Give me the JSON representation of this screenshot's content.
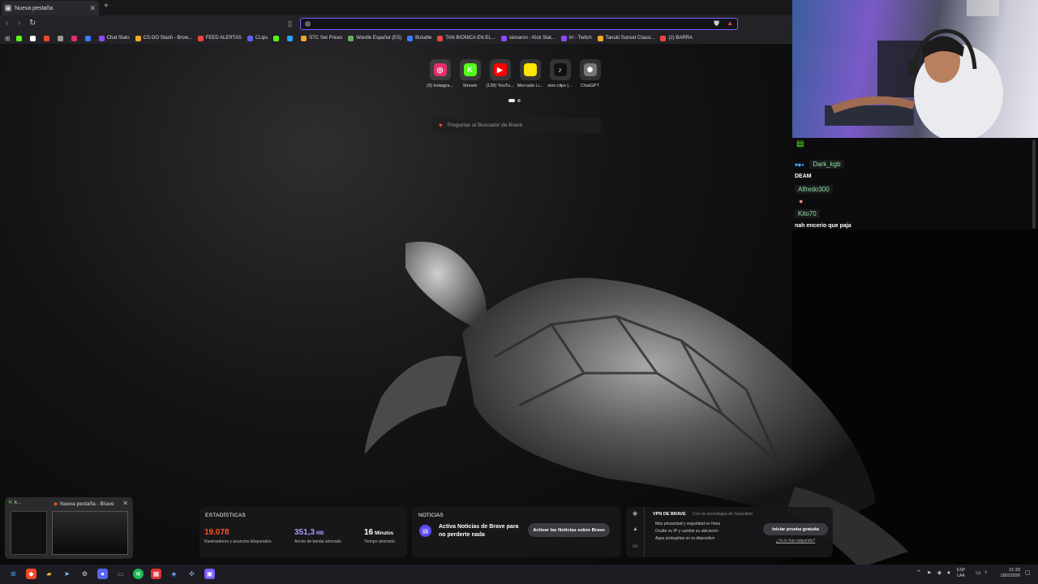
{
  "browser": {
    "tab_title": "Nueva pestaña",
    "new_tab_symbol": "+",
    "url_value": "",
    "bookmarks": [
      {
        "label": "",
        "color": "#53fc18"
      },
      {
        "label": "",
        "color": "#ffffff"
      },
      {
        "label": "",
        "color": "#f14a28"
      },
      {
        "label": "",
        "color": "#999999"
      },
      {
        "label": "",
        "color": "#e1306c"
      },
      {
        "label": "",
        "color": "#3a7afe"
      },
      {
        "label": "Chat Stats",
        "color": "#9147ff"
      },
      {
        "label": "CS:GO Stash - Brow...",
        "color": "#f1a928"
      },
      {
        "label": "FEED ALERTAS",
        "color": "#e44"
      },
      {
        "label": "CLips",
        "color": "#5865f2"
      },
      {
        "label": "",
        "color": "#53fc18"
      },
      {
        "label": "",
        "color": "#2aa4f4"
      },
      {
        "label": "STC Set Prices",
        "color": "#f1a928"
      },
      {
        "label": "Wordle Español (ES)",
        "color": "#6aaa64"
      },
      {
        "label": "Boludle",
        "color": "#3a7afe"
      },
      {
        "label": "TAN BIONICA EN EL...",
        "color": "#e44"
      },
      {
        "label": "sionaron - Kick Stat...",
        "color": "#9147ff"
      },
      {
        "label": "trr - Twitch",
        "color": "#9147ff"
      },
      {
        "label": "Tanuki Sunset Classi...",
        "color": "#f1a928"
      },
      {
        "label": "(2) BARRA",
        "color": "#e44"
      }
    ]
  },
  "newtab": {
    "top_sites": [
      {
        "label": "(9) Instagra...",
        "icon": "instagram-icon",
        "color": "#e1306c",
        "glyph": "◎"
      },
      {
        "label": "Stream",
        "icon": "kick-icon",
        "color": "#53fc18",
        "glyph": "K"
      },
      {
        "label": "(128) YouTu...",
        "icon": "youtube-icon",
        "color": "#ff0000",
        "glyph": "▶"
      },
      {
        "label": "Mercado Li...",
        "icon": "mercadolibre-icon",
        "color": "#ffe600",
        "glyph": "◌"
      },
      {
        "label": "sion.clips (...",
        "icon": "tiktok-icon",
        "color": "#111111",
        "glyph": "♪"
      },
      {
        "label": "ChatGPT",
        "icon": "chatgpt-icon",
        "color": "#777777",
        "glyph": "✺"
      }
    ],
    "search_placeholder": "Preguntar al Buscador de Brave"
  },
  "stats": {
    "title": "ESTADÍSTICAS",
    "trackers_value": "19.078",
    "trackers_label": "Rastreadores y anuncios bloqueados",
    "bandwidth_value": "351,3",
    "bandwidth_unit": "MB",
    "bandwidth_label": "Ancho de banda ahorrado",
    "time_value": "16",
    "time_unit": "Minutos",
    "time_label": "Tiempo ahorrado",
    "colors": {
      "trackers": "#fb542b",
      "bandwidth": "#a59bff",
      "time": "#ffffff"
    }
  },
  "news": {
    "title": "NOTICIAS",
    "message": "Activa Noticias de Brave para no perderte nada",
    "button": "Activar las Noticias sobre Brave"
  },
  "vpn": {
    "title": "VPN DE BRAVE",
    "powered": "Con la tecnología de Guardian",
    "features": [
      "Más privacidad y seguridad en línea",
      "Oculte su IP y cambie su ubicación",
      "Apps protegidas en tu dispositivo"
    ],
    "button": "Iniciar prueba gratuita",
    "link": "¿Ya lo has adquirido?"
  },
  "preview": {
    "first_label": "k...",
    "second_label": "Nueva pestaña - Brave"
  },
  "taskbar": {
    "lang_line1": "ESP",
    "lang_line2": "LAA",
    "time": "21:33",
    "date": "18/2/2026"
  },
  "chat": {
    "messages": [
      {
        "user": "Dark_kgb",
        "text": "DEAM"
      },
      {
        "user": "Alfredo300",
        "text": ""
      },
      {
        "user": "Kito70",
        "text": "nah encerio que paja"
      }
    ]
  }
}
